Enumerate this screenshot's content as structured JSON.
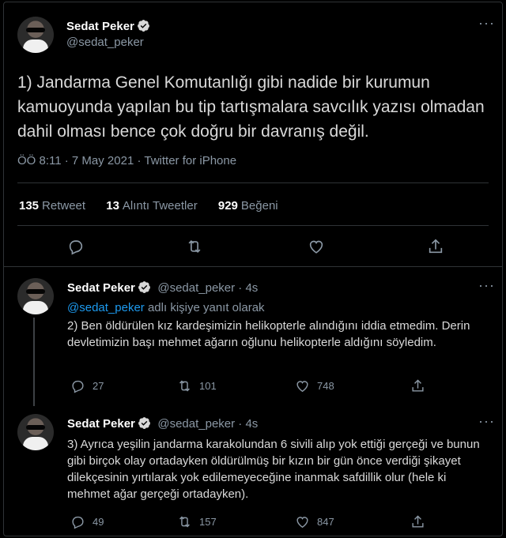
{
  "main_tweet": {
    "name": "Sedat Peker",
    "handle": "@sedat_peker",
    "text": "1) Jandarma Genel Komutanlığı gibi nadide bir kurumun kamuoyunda yapılan bu tip tartışmalara savcılık yazısı olmadan dahil olması bence çok doğru bir davranış değil.",
    "meta": "ÖÖ 8:11 · 7 May 2021 · Twitter for iPhone",
    "retweets": "135",
    "retweets_label": "Retweet",
    "quotes": "13",
    "quotes_label": "Alıntı Tweetler",
    "likes": "929",
    "likes_label": "Beğeni"
  },
  "replies": [
    {
      "name": "Sedat Peker",
      "handle_time": "@sedat_peker · 4s",
      "reply_to_link": "@sedat_peker",
      "reply_to_suffix": " adlı kişiye yanıt olarak",
      "text": "2) Ben öldürülen kız kardeşimizin helikopterle alındığını iddia etmedim. Derin devletimizin başı mehmet ağarın oğlunu helikopterle aldığını söyledim.",
      "replies": "27",
      "retweets": "101",
      "likes": "748"
    },
    {
      "name": "Sedat Peker",
      "handle_time": "@sedat_peker · 4s",
      "text": "3) Ayrıca yeşilin jandarma karakolundan 6 sivili alıp yok ettiği gerçeği ve bunun gibi birçok olay ortadayken öldürülmüş bir kızın bir gün önce verdiği şikayet dilekçesinin yırtılarak yok edilemeyeceğine inanmak safdillik olur (hele ki mehmet ağar gerçeği ortadayken).",
      "replies": "49",
      "retweets": "157",
      "likes": "847"
    }
  ],
  "icons": [
    "verified-icon",
    "more-icon",
    "reply-icon",
    "retweet-icon",
    "like-icon",
    "share-icon"
  ],
  "colors": {
    "background": "#000000",
    "link": "#1d9bf0",
    "verified": "#1d9bf0",
    "muted": "#8b98a5"
  }
}
